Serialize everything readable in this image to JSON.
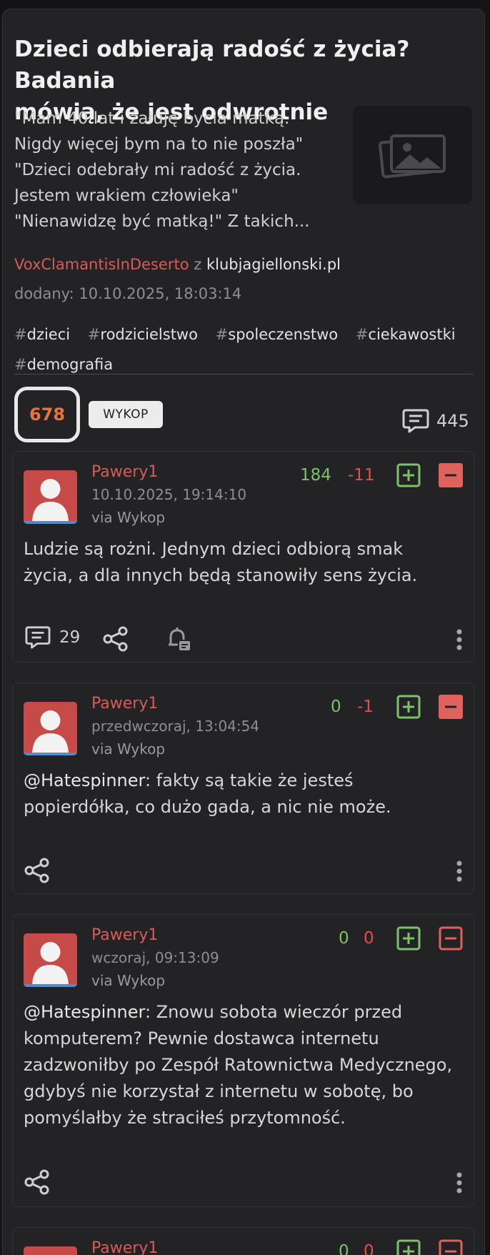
{
  "article": {
    "title_lines": [
      "Dzieci odbierają radość z życia? Badania",
      "mówią, że jest odwrotnie"
    ],
    "excerpt_lines": [
      "\"Mam 40 lat i żałuję bycia matką.",
      "Nigdy więcej bym na to nie poszła\"",
      "\"Dzieci odebrały mi radość z życia.",
      "Jestem wrakiem człowieka\"",
      "\"Nienawidzę być matką!\" Z takich..."
    ],
    "author": "VoxClamantisInDeserto",
    "from_word": "z",
    "source_domain": "klubjagiellonski.pl",
    "added": "dodany: 10.10.2025, 18:03:14",
    "tags": [
      "dzieci",
      "rodzicielstwo",
      "spoleczenstwo",
      "ciekawostki",
      "demografia"
    ],
    "tag_prefix": "#",
    "votes": "678",
    "wykop_label": "WYKOP",
    "comment_count": "445"
  },
  "comments": [
    {
      "author": "Pawery1",
      "date": "10.10.2025, 19:14:10",
      "via": "via Wykop",
      "plus": "184",
      "minus": "-11",
      "text_lines": [
        "Ludzie są rożni. Jednym dzieci odbiorą smak",
        "życia, a dla innych będą stanowiły sens życia."
      ],
      "replies": "29"
    },
    {
      "author": "Pawery1",
      "date": "przedwczoraj, 13:04:54",
      "via": "via Wykop",
      "plus": "0",
      "minus": "-1",
      "mention": "@Hatespinner",
      "text_lines": [
        ": fakty są takie że jesteś",
        "popierdółka, co dużo gada, a nic nie może."
      ]
    },
    {
      "author": "Pawery1",
      "date": "wczoraj, 09:13:09",
      "via": "via Wykop",
      "plus": "0",
      "minus": "0",
      "mention": "@Hatespinner",
      "text_lines": [
        ": Znowu sobota wieczór przed",
        "komputerem? Pewnie dostawca internetu",
        "zadzwoniłby po Zespół Ratownictwa Medycznego,",
        "gdybyś nie korzystał z internetu w sobotę, bo",
        "pomyślałby że straciłeś przytomność."
      ]
    },
    {
      "author": "Pawery1",
      "plus": "0",
      "minus": "0"
    }
  ],
  "colors": {
    "background": "#141416",
    "card": "#232326",
    "author_red": "#d95b55",
    "plus_green": "#7cc26a",
    "minus_red": "#e0504d",
    "vote_orange": "#e8743b"
  },
  "icons": [
    "image-placeholder-icon",
    "comments-icon",
    "share-icon",
    "bell-observe-icon",
    "more-vertical-icon",
    "plus-vote-icon",
    "minus-vote-icon",
    "avatar-icon"
  ]
}
